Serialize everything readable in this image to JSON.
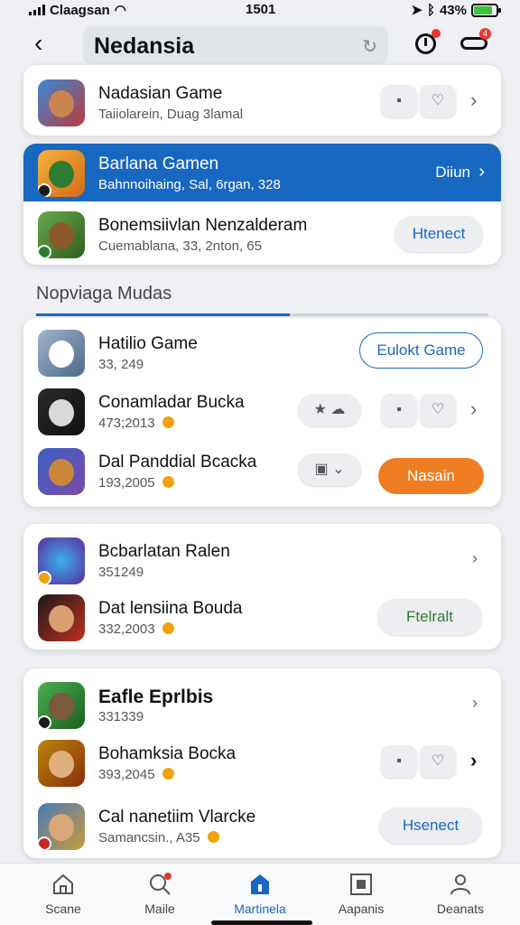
{
  "status": {
    "carrier": "Claagsan",
    "time": "1501",
    "battery": "43%"
  },
  "header": {
    "search_value": "Nedansia"
  },
  "top_card": [
    {
      "name": "Nadasian Game",
      "sub": "Taiiolarein, Duag 3lamal"
    }
  ],
  "selected_card": [
    {
      "name": "Barlana Gamen",
      "sub": "Bahnnoihaing, Sal, 6rgan, 328",
      "action": "Diiun"
    },
    {
      "name": "Bonemsiivlan Nenzalderam",
      "sub": "Cuemablana, 33, 2nton, 65",
      "action": "Htenect"
    }
  ],
  "section": {
    "title": "Nopviaga Mudas"
  },
  "card2": [
    {
      "name": "Hatilio Game",
      "sub": "33, 249",
      "action": "Eulokt Game"
    },
    {
      "name": "Conamladar Bucka",
      "sub": "473;2013"
    },
    {
      "name": "Dal Panddial Bcacka",
      "sub": "193,2005",
      "action": "Nasain"
    }
  ],
  "card3": [
    {
      "name": "Bcbarlatan Ralen",
      "sub": "351249"
    },
    {
      "name": "Dat lensiina Bouda",
      "sub": "332,2003",
      "action": "Ftelralt"
    }
  ],
  "card4": [
    {
      "name": "Eafle Eprlbis",
      "sub": "331339"
    },
    {
      "name": "Bohamksia Bocka",
      "sub": "393,2045"
    },
    {
      "name": "Cal nanetiim Vlarcke",
      "sub": "Samancsin., A35",
      "action": "Hsenect"
    }
  ],
  "tabs": [
    "Scane",
    "Maile",
    "Martinela",
    "Aapanis",
    "Deanats"
  ],
  "colors": {
    "accent": "#1867c0",
    "orange": "#ef7d22",
    "green": "#2e7d32"
  }
}
